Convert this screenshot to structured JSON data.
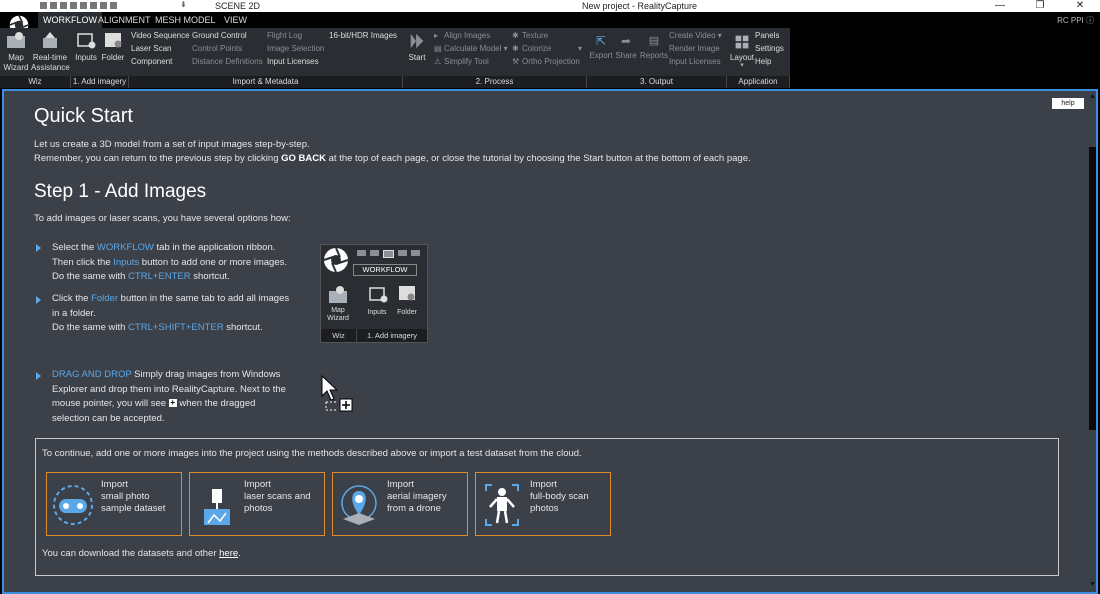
{
  "window": {
    "scene": "SCENE 2D",
    "title": "New project - RealityCapture",
    "min": "—",
    "restore": "❐",
    "close": "✕"
  },
  "tabs": [
    "WORKFLOW",
    "ALIGNMENT",
    "MESH MODEL",
    "VIEW"
  ],
  "rc_ppi": "RC PPI ⓘ",
  "ribbon": {
    "map_wizard": "Map\nWizard",
    "realtime": "Real-time\nAssistance",
    "inputs": "Inputs",
    "folder": "Folder",
    "video_sequence": "Video Sequence",
    "laser_scan": "Laser Scan",
    "component": "Component",
    "ground_control": "Ground Control",
    "control_points": "Control Points",
    "distance_definitions": "Distance Definitions",
    "flight_log": "Flight Log",
    "image_selection": "Image Selection",
    "input_licenses": "Input Licenses",
    "hdr_images": "16-bit/HDR Images",
    "start": "Start",
    "align_images": "Align Images",
    "calculate_model": "Calculate Model ▾",
    "simplify_tool": "Simplify Tool",
    "texture": "Texture",
    "colorize": "Colorize",
    "ortho_projection": "Ortho Projection",
    "export": "Export",
    "share": "Share",
    "reports": "Reports",
    "create_video": "Create Video ▾",
    "render_image": "Render Image",
    "input_licenses_out": "Input Licenses",
    "layout": "Layout",
    "panels": "Panels",
    "settings": "Settings",
    "help": "Help",
    "groups": [
      "Wiz",
      "1. Add imagery",
      "Import & Metadata",
      "2. Process",
      "3. Output",
      "Application"
    ]
  },
  "content": {
    "help_button": "help",
    "title": "Quick Start",
    "intro1": "Let us create a 3D model from a set of input images step-by-step.",
    "intro2_a": "Remember, you can return to the previous step by clicking ",
    "intro2_b": "GO BACK",
    "intro2_c": " at the top of each page, or close the tutorial by choosing the Start button at the bottom of each page.",
    "step_title": "Step 1 - Add Images",
    "options_text": "To add images or laser scans, you have several options how:",
    "b1_l1_a": "Select the ",
    "b1_l1_b": "WORKFLOW",
    "b1_l1_c": " tab in the application ribbon.",
    "b1_l2_a": "Then click the ",
    "b1_l2_b": "Inputs",
    "b1_l2_c": " button to add one or more images.",
    "b1_l3_a": "Do the same with ",
    "b1_l3_b": "CTRL+ENTER",
    "b1_l3_c": " shortcut.",
    "b2_l1_a": "Click the ",
    "b2_l1_b": "Folder",
    "b2_l1_c": " button in the same tab to add all images",
    "b2_l2": "in a folder.",
    "b2_l3_a": "Do the same with ",
    "b2_l3_b": "CTRL+SHIFT+ENTER",
    "b2_l3_c": " shortcut.",
    "b3_l1_a": "DRAG AND DROP",
    "b3_l1_b": " Simply drag images from Windows",
    "b3_l2": "Explorer and drop them into RealityCapture. Next to the",
    "b3_l3_a": "mouse pointer, you will see ",
    "b3_l3_b": " when the dragged",
    "b3_l4": "selection can be accepted.",
    "shot": {
      "tab": "WORKFLOW",
      "map_wizard": "Map\nWizard",
      "inputs": "Inputs",
      "folder": "Folder",
      "wiz": "Wiz",
      "add_imagery": "1. Add imagery"
    },
    "continue_text": "To continue, add one or more images into the project using the methods described above or import a test dataset from the cloud.",
    "imports": [
      {
        "label": "Import\nsmall photo\nsample dataset"
      },
      {
        "label": "Import\nlaser scans and\nphotos"
      },
      {
        "label": "Import\naerial imagery\nfrom a drone"
      },
      {
        "label": "Import\nfull-body scan\nphotos"
      }
    ],
    "download_a": "You can download the datasets and other ",
    "download_link": "here",
    "download_c": "."
  }
}
